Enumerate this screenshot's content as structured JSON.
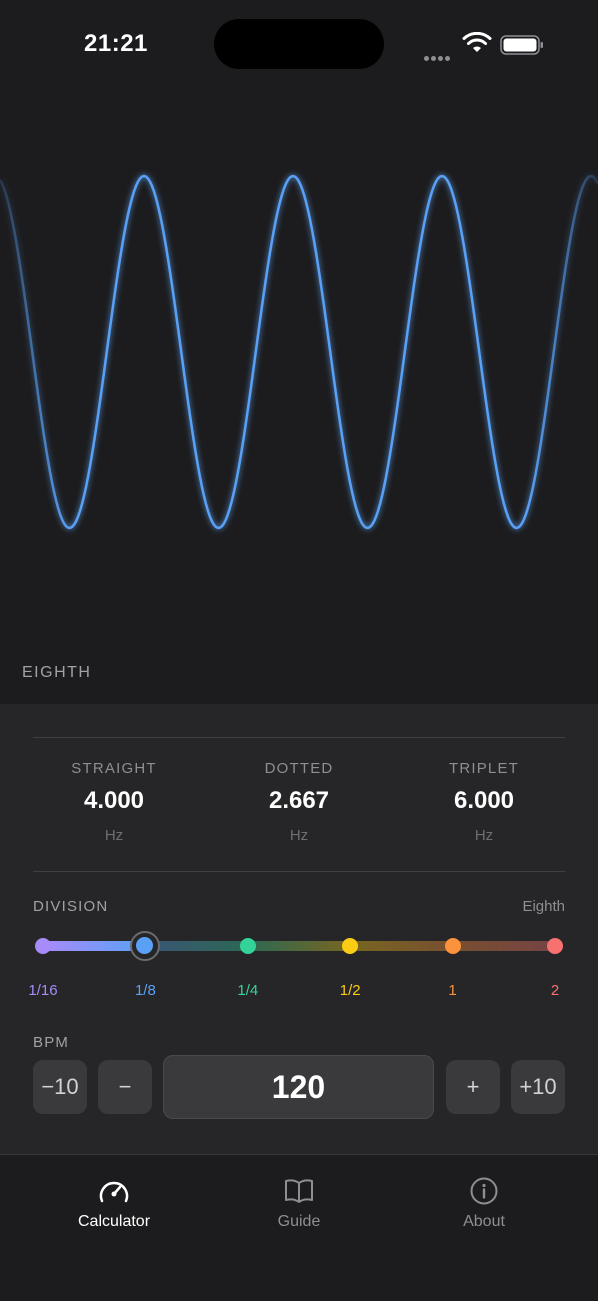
{
  "status_bar": {
    "time": "21:21"
  },
  "wave": {
    "label": "EIGHTH",
    "color": "#5aa1f5",
    "cycles_visible": 3
  },
  "rates": [
    {
      "label": "STRAIGHT",
      "value": "4.000",
      "unit": "Hz"
    },
    {
      "label": "DOTTED",
      "value": "2.667",
      "unit": "Hz"
    },
    {
      "label": "TRIPLET",
      "value": "6.000",
      "unit": "Hz"
    }
  ],
  "division": {
    "label": "DIVISION",
    "selected_name": "Eighth",
    "selected_index": 1,
    "options": [
      {
        "label": "1/16",
        "color": "#a78bfa"
      },
      {
        "label": "1/8",
        "color": "#5aa1f5"
      },
      {
        "label": "1/4",
        "color": "#34d399"
      },
      {
        "label": "1/2",
        "color": "#facc15"
      },
      {
        "label": "1",
        "color": "#fb923c"
      },
      {
        "label": "2",
        "color": "#f87171"
      }
    ]
  },
  "bpm": {
    "label": "BPM",
    "value": "120",
    "minus10": "−10",
    "minus1": "−",
    "plus1": "+",
    "plus10": "+10"
  },
  "tabs": [
    {
      "label": "Calculator",
      "icon": "gauge-icon",
      "active": true
    },
    {
      "label": "Guide",
      "icon": "book-icon",
      "active": false
    },
    {
      "label": "About",
      "icon": "info-icon",
      "active": false
    }
  ]
}
